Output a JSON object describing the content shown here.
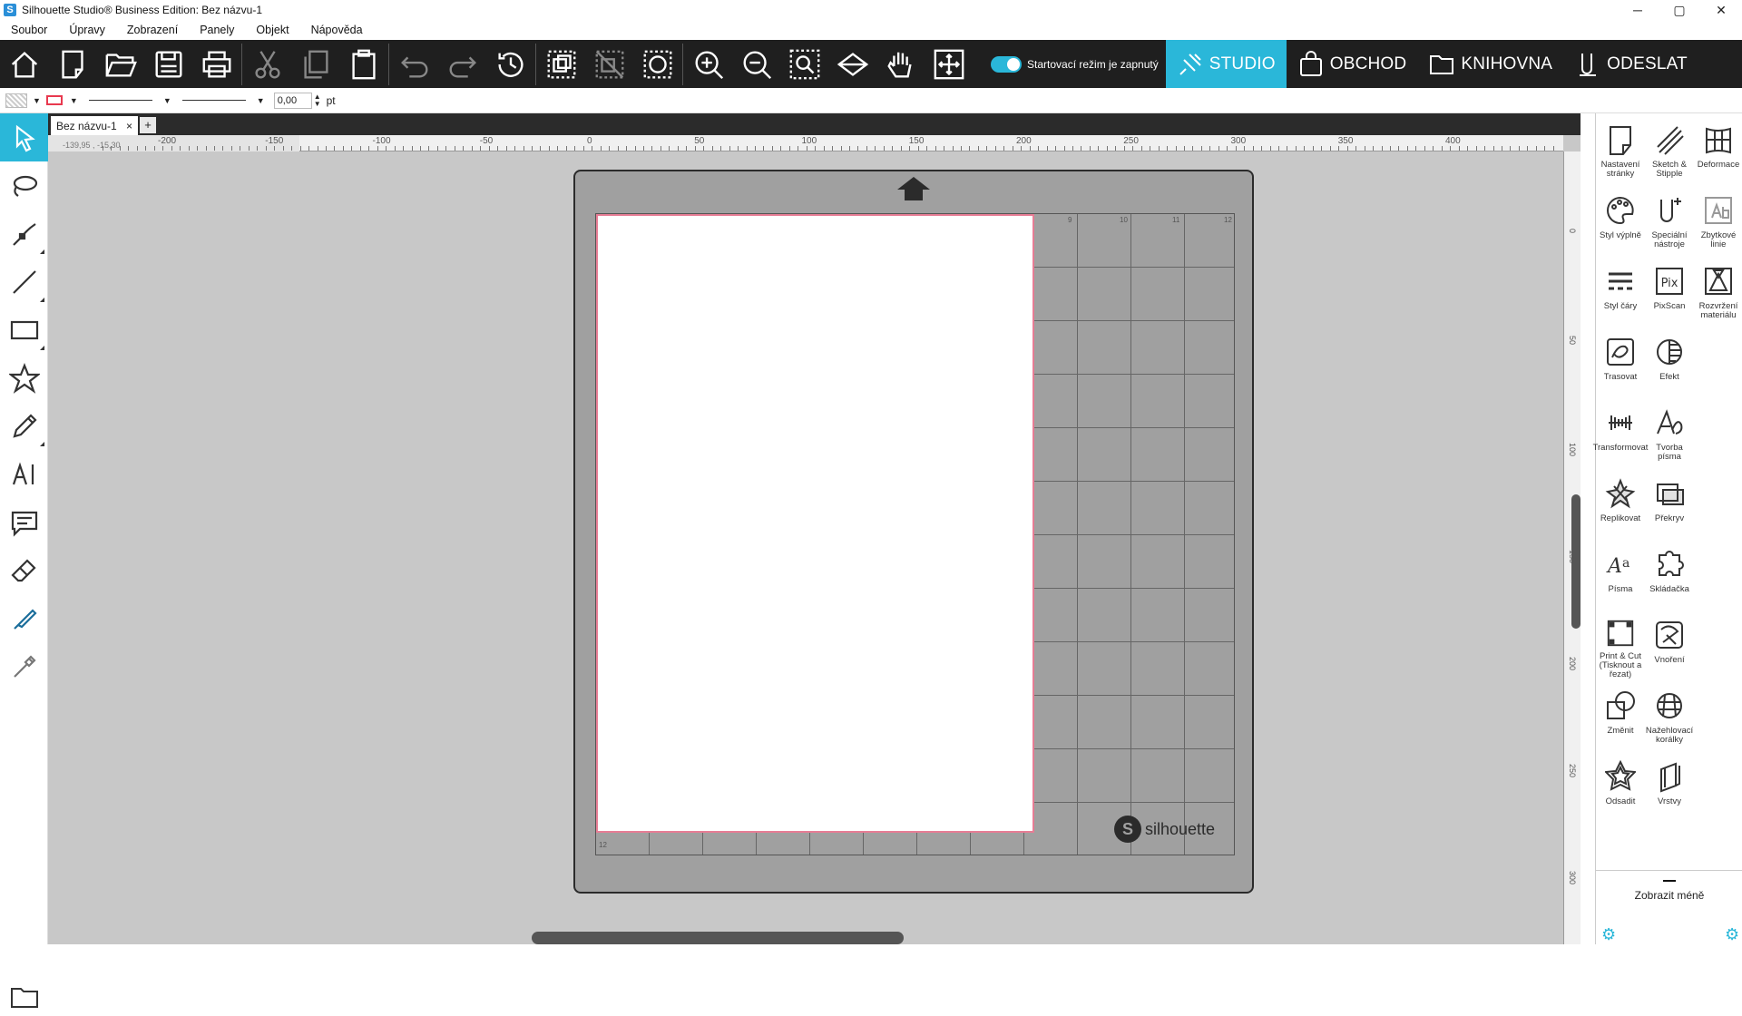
{
  "window": {
    "title": "Silhouette Studio® Business Edition: Bez názvu-1",
    "minimize": "─",
    "maximize": "▢",
    "close": "✕"
  },
  "menu": [
    "Soubor",
    "Úpravy",
    "Zobrazení",
    "Panely",
    "Objekt",
    "Nápověda"
  ],
  "toolbar": {
    "toggle_label": "Startovací režim je zapnutý",
    "tabs": [
      {
        "label": "STUDIO",
        "icon": "studio-icon",
        "active": true
      },
      {
        "label": "OBCHOD",
        "icon": "shop-bag-icon",
        "active": false
      },
      {
        "label": "KNIHOVNA",
        "icon": "folder-icon",
        "active": false
      },
      {
        "label": "ODESLAT",
        "icon": "send-blade-icon",
        "active": false
      }
    ]
  },
  "propbar": {
    "line_width_value": "0,00",
    "line_width_unit": "pt"
  },
  "document": {
    "tab_label": "Bez názvu-1",
    "tab_close": "×",
    "tab_add": "+",
    "coords": "-139,95 , -15,30"
  },
  "ruler_h": [
    "-200",
    "-150",
    "-100",
    "-50",
    "0",
    "50",
    "100",
    "150",
    "200",
    "250",
    "300",
    "350",
    "400"
  ],
  "ruler_v": [
    "0",
    "50",
    "100",
    "150",
    "200",
    "250",
    "300"
  ],
  "mat": {
    "brand": "silhouette",
    "logo_letter": "S",
    "numbers_top": [
      "9",
      "10",
      "11",
      "12"
    ],
    "number_bottom": "12"
  },
  "right_panel": {
    "items": [
      {
        "label": "Nastavení stránky",
        "icon": "page-setup-icon"
      },
      {
        "label": "Sketch & Stipple",
        "icon": "sketch-icon"
      },
      {
        "label": "Deformace",
        "icon": "warp-icon"
      },
      {
        "label": "Styl výplně",
        "icon": "palette-icon"
      },
      {
        "label": "Speciální nástroje",
        "icon": "special-tools-icon"
      },
      {
        "label": "Zbytkové linie",
        "icon": "offcut-icon"
      },
      {
        "label": "Styl čáry",
        "icon": "line-style-icon"
      },
      {
        "label": "PixScan",
        "icon": "pixscan-icon"
      },
      {
        "label": "Rozvržení materiálu",
        "icon": "nesting-icon"
      },
      {
        "label": "Trasovat",
        "icon": "trace-icon"
      },
      {
        "label": "Efekt",
        "icon": "effect-icon"
      },
      {
        "label": "",
        "icon": "blank-icon"
      },
      {
        "label": "Transformovat",
        "icon": "transform-icon"
      },
      {
        "label": "Tvorba písma",
        "icon": "font-create-icon"
      },
      {
        "label": "",
        "icon": "blank-icon"
      },
      {
        "label": "Replikovat",
        "icon": "replicate-icon"
      },
      {
        "label": "Překryv",
        "icon": "overlay-icon"
      },
      {
        "label": "",
        "icon": "blank-icon"
      },
      {
        "label": "Písma",
        "icon": "fonts-icon"
      },
      {
        "label": "Skládačka",
        "icon": "puzzle-icon"
      },
      {
        "label": "",
        "icon": "blank-icon"
      },
      {
        "label": "Print & Cut (Tisknout a řezat)",
        "icon": "print-cut-icon"
      },
      {
        "label": "Vnoření",
        "icon": "embed-icon"
      },
      {
        "label": "",
        "icon": "blank-icon"
      },
      {
        "label": "Změnit",
        "icon": "modify-icon"
      },
      {
        "label": "Nažehlovací korálky",
        "icon": "rhinestone-icon"
      },
      {
        "label": "",
        "icon": "blank-icon"
      },
      {
        "label": "Odsadit",
        "icon": "offset-icon"
      },
      {
        "label": "Vrstvy",
        "icon": "layers-icon"
      },
      {
        "label": "",
        "icon": "blank-icon"
      }
    ],
    "show_less": "Zobrazit méně"
  }
}
